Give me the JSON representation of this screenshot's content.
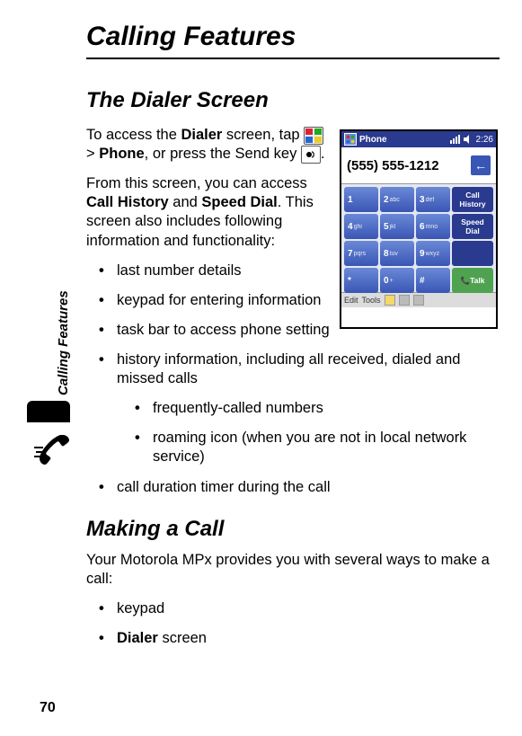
{
  "sidebar_label": "Calling Features",
  "page_number": "70",
  "title": "Calling Features",
  "section1": {
    "heading": "The Dialer Screen",
    "p1_a": "To access the ",
    "p1_dialer": "Dialer",
    "p1_b": " screen, tap ",
    "p1_c": " > ",
    "p1_phone": "Phone",
    "p1_d": ", or press the Send key ",
    "p1_e": ".",
    "p2_a": "From this screen, you can access ",
    "p2_ch": "Call History",
    "p2_b": " and ",
    "p2_sd": "Speed Dial",
    "p2_c": ". This screen also includes following information and functionality:",
    "bullets_narrow": [
      "last number details",
      "keypad for entering information",
      "task bar to access phone setting"
    ],
    "bullets_full": [
      "history information, including all received, dialed and missed calls"
    ],
    "sub_bullets": [
      "frequently-called numbers",
      "roaming icon (when you are not in local network service)"
    ],
    "bullets_after": [
      "call duration timer during the call"
    ]
  },
  "section2": {
    "heading": "Making a Call",
    "p1": "Your Motorola MPx provides you with several ways to make a call:",
    "bullets": [
      {
        "text": "keypad"
      },
      {
        "bold": "Dialer",
        "text": " screen"
      }
    ]
  },
  "screenshot": {
    "title": "Phone",
    "time": "2:26",
    "number": "(555) 555-1212",
    "keys": [
      [
        "1",
        ""
      ],
      [
        "2",
        "abc"
      ],
      [
        "3",
        "def"
      ],
      [
        "4",
        "ghi"
      ],
      [
        "5",
        "jkl"
      ],
      [
        "6",
        "mno"
      ],
      [
        "7",
        "pqrs"
      ],
      [
        "8",
        "tuv"
      ],
      [
        "9",
        "wxyz"
      ],
      [
        "*",
        ""
      ],
      [
        "0",
        "+"
      ],
      [
        "#",
        ""
      ]
    ],
    "side": [
      "Call History",
      "Speed Dial",
      "",
      "Talk"
    ],
    "bottom_left": "Edit",
    "bottom_right": "Tools"
  }
}
